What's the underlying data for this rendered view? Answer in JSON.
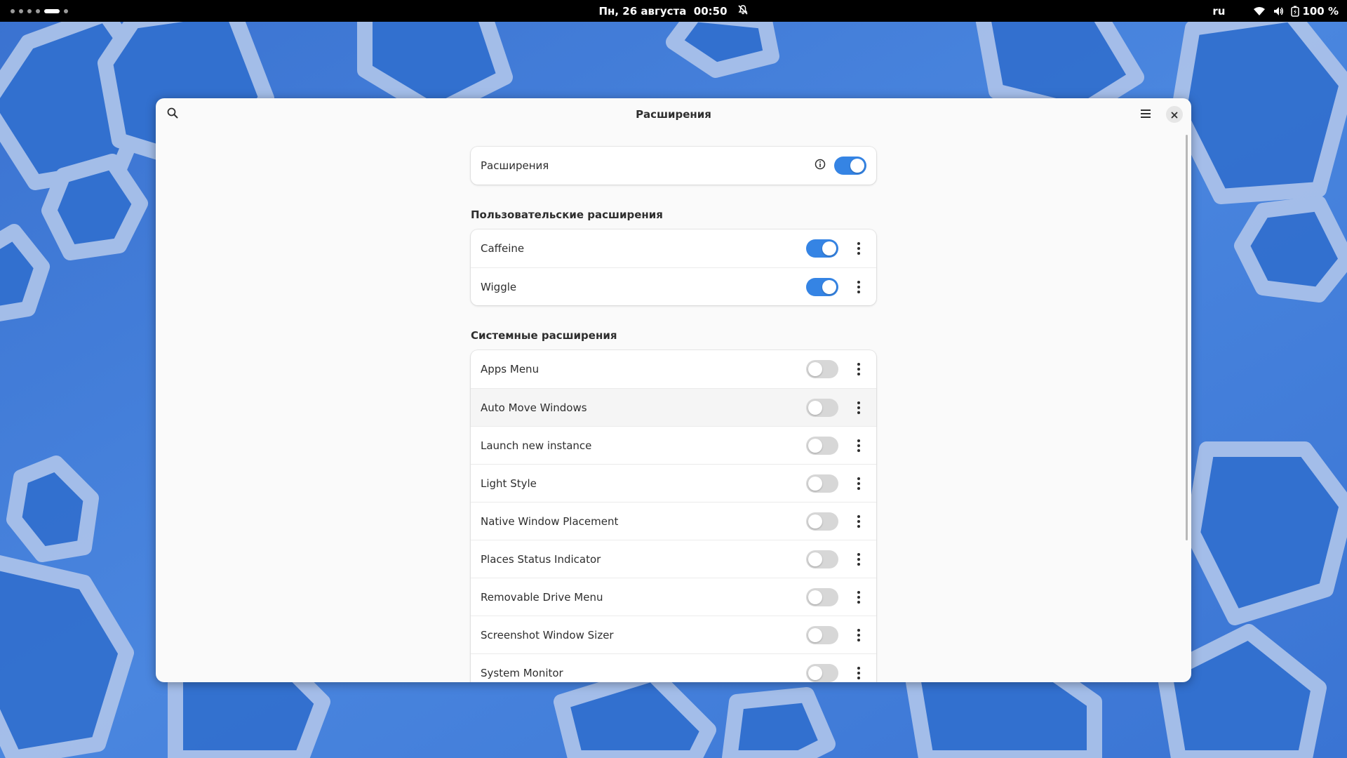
{
  "topbar": {
    "clock": "Пн, 26 августа  00:50",
    "language": "ru",
    "battery": "100 %"
  },
  "window": {
    "title": "Расширения",
    "main_toggle": {
      "label": "Расширения",
      "enabled": true
    },
    "user_section": {
      "title": "Пользовательские расширения",
      "items": [
        {
          "label": "Caffeine",
          "enabled": true
        },
        {
          "label": "Wiggle",
          "enabled": true
        }
      ]
    },
    "system_section": {
      "title": "Системные расширения",
      "items": [
        {
          "label": "Apps Menu",
          "enabled": false
        },
        {
          "label": "Auto Move Windows",
          "enabled": false
        },
        {
          "label": "Launch new instance",
          "enabled": false
        },
        {
          "label": "Light Style",
          "enabled": false
        },
        {
          "label": "Native Window Placement",
          "enabled": false
        },
        {
          "label": "Places Status Indicator",
          "enabled": false
        },
        {
          "label": "Removable Drive Menu",
          "enabled": false
        },
        {
          "label": "Screenshot Window Sizer",
          "enabled": false
        },
        {
          "label": "System Monitor",
          "enabled": false
        }
      ]
    }
  },
  "colors": {
    "accent": "#3584e4",
    "wallpaper": "#3c7ad6"
  },
  "icons": [
    "search-icon",
    "hamburger-menu-icon",
    "close-icon",
    "info-icon",
    "wifi-icon",
    "volume-icon",
    "battery-icon",
    "notifications-off-icon",
    "more-vertical-icon"
  ]
}
